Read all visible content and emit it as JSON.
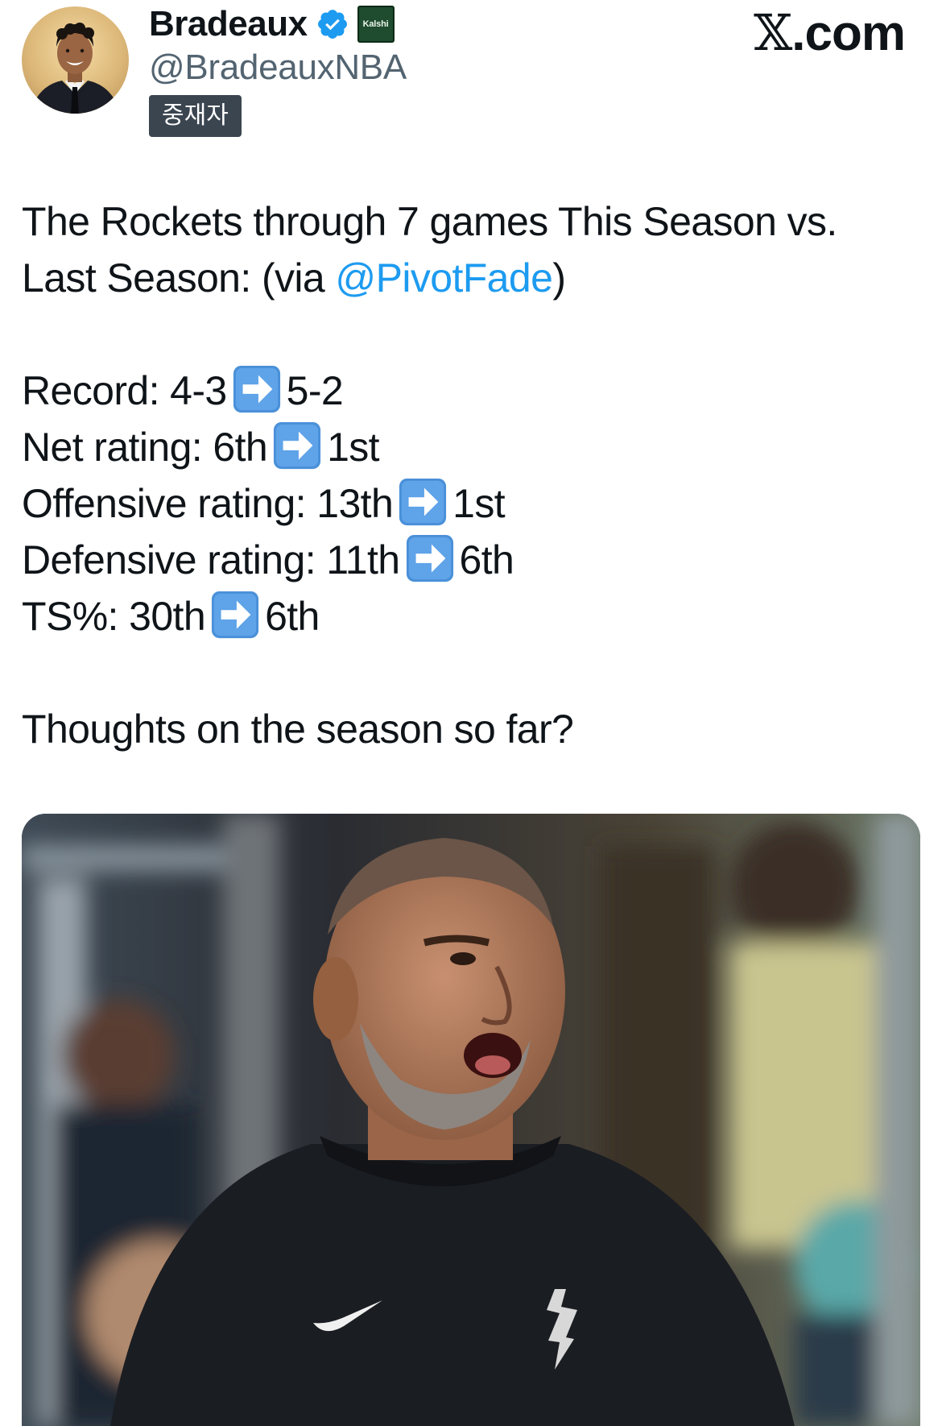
{
  "author": {
    "display_name": "Bradeaux",
    "handle": "@BradeauxNBA",
    "verified_icon": "verified-checkmark-icon",
    "verified_color": "#1d9bf0",
    "affiliate_badge": "Kalshi",
    "label": "중재자"
  },
  "site": {
    "logo_x": "𝕏",
    "logo_domain": ".com"
  },
  "tweet": {
    "intro_line1": "The Rockets through 7 games This Season vs.",
    "intro_line2_prefix": "Last Season: (via ",
    "intro_mention": "@PivotFade",
    "intro_line2_suffix": ")",
    "stats": [
      {
        "label": "Record: 4-3",
        "after": "5-2"
      },
      {
        "label": "Net rating: 6th",
        "after": "1st"
      },
      {
        "label": "Offensive rating: 13th",
        "after": "1st"
      },
      {
        "label": "Defensive rating: 11th",
        "after": "6th"
      },
      {
        "label": "TS%: 30th",
        "after": "6th"
      }
    ],
    "arrow_icon": "right-arrow-emoji-icon",
    "closing": "Thoughts on the season so far?",
    "mention_color": "#1d9bf0"
  },
  "media": {
    "image_icon": "coach-photo"
  }
}
